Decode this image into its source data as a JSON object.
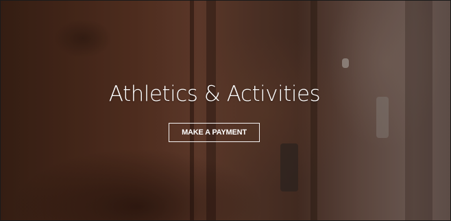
{
  "hero": {
    "title": "Athletics & Activities",
    "button_label": "MAKE A PAYMENT",
    "background_image": "blurred-wooden-lockers-photo",
    "text_color": "#ffffff"
  }
}
